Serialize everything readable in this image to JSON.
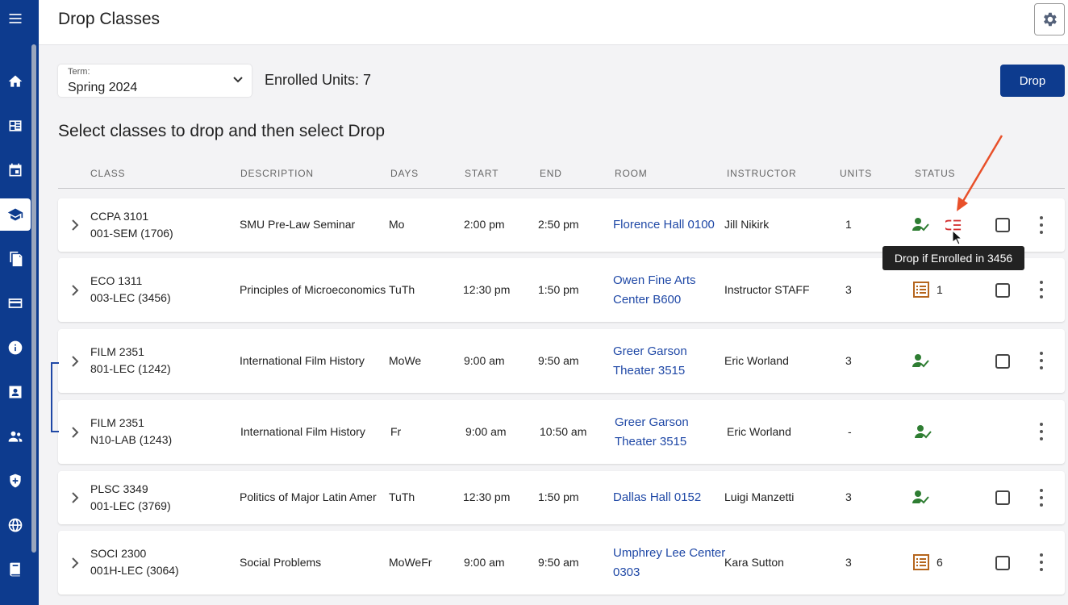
{
  "header": {
    "title": "Drop Classes"
  },
  "term": {
    "label": "Term:",
    "value": "Spring 2024"
  },
  "enrolled_units": "Enrolled Units: 7",
  "drop_label": "Drop",
  "instructions": "Select classes to drop and then select Drop",
  "columns": [
    "CLASS",
    "DESCRIPTION",
    "DAYS",
    "START",
    "END",
    "ROOM",
    "INSTRUCTOR",
    "UNITS",
    "STATUS"
  ],
  "rows": [
    {
      "class": "CCPA 3101",
      "section": "001-SEM (1706)",
      "description": "SMU Pre-Law Seminar",
      "days": "Mo",
      "start": "2:00 pm",
      "end": "2:50 pm",
      "room": "Florence Hall 0100",
      "instructor": "Jill Nikirk",
      "units": "1",
      "status": "enrolled",
      "conditional": true
    },
    {
      "class": "ECO 1311",
      "section": "003-LEC (3456)",
      "description": "Principles of Microeconomics",
      "days": "TuTh",
      "start": "12:30 pm",
      "end": "1:50 pm",
      "room_line1": "Owen Fine Arts",
      "room_line2": "Center B600",
      "instructor": "Instructor STAFF",
      "units": "3",
      "status": "waitlist",
      "waitlist_pos": "1"
    },
    {
      "class": "FILM 2351",
      "section": "801-LEC (1242)",
      "description": "International Film History",
      "days": "MoWe",
      "start": "9:00 am",
      "end": "9:50 am",
      "room_line1": "Greer Garson",
      "room_line2": "Theater 3515",
      "instructor": "Eric Worland",
      "units": "3",
      "status": "enrolled"
    },
    {
      "class": "FILM 2351",
      "section": "N10-LAB (1243)",
      "description": "International Film History",
      "days": "Fr",
      "start": "9:00 am",
      "end": "10:50 am",
      "room_line1": "Greer Garson",
      "room_line2": "Theater 3515",
      "instructor": "Eric Worland",
      "units": "-",
      "status": "enrolled"
    },
    {
      "class": "PLSC 3349",
      "section": "001-LEC (3769)",
      "description": "Politics of Major Latin Amer",
      "days": "TuTh",
      "start": "12:30 pm",
      "end": "1:50 pm",
      "room": "Dallas Hall 0152",
      "instructor": "Luigi Manzetti",
      "units": "3",
      "status": "enrolled"
    },
    {
      "class": "SOCI 2300",
      "section": "001H-LEC (3064)",
      "description": "Social Problems",
      "days": "MoWeFr",
      "start": "9:00 am",
      "end": "9:50 am",
      "room_line1": "Umphrey Lee Center",
      "room_line2": "0303",
      "instructor": "Kara Sutton",
      "units": "3",
      "status": "waitlist",
      "waitlist_pos": "6"
    }
  ],
  "tooltip": "Drop if Enrolled in 3456",
  "colors": {
    "brand": "#0d3b8e",
    "enrolled": "#2e7d32",
    "waitlist": "#b5651d",
    "conditional": "#d32f2f",
    "link": "#1f48a6"
  },
  "sidebar_icons": [
    "menu-icon",
    "home-icon",
    "dashboard-icon",
    "calendar-icon",
    "graduation-cap-icon",
    "documents-icon",
    "credit-card-icon",
    "info-icon",
    "id-card-icon",
    "people-icon",
    "shield-icon",
    "globe-icon",
    "book-icon"
  ]
}
